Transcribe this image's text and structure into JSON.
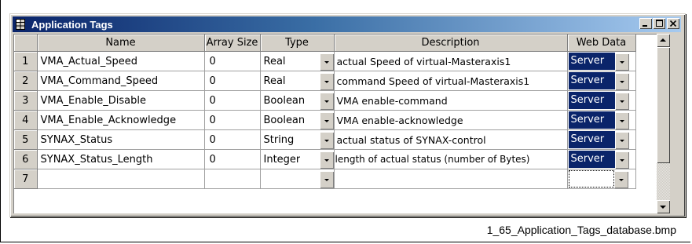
{
  "window": {
    "title": "Application Tags",
    "buttons": {
      "minimize": "_",
      "maximize": "□",
      "close": "✕"
    }
  },
  "table": {
    "headers": {
      "rownum": "",
      "name": "Name",
      "array_size": "Array Size",
      "type": "Type",
      "description": "Description",
      "web_data": "Web Data"
    },
    "rows": [
      {
        "num": "1",
        "name": "VMA_Actual_Speed",
        "array_size": "0",
        "type": "Real",
        "description": "actual Speed of virtual-Masteraxis1",
        "web_data": "Server"
      },
      {
        "num": "2",
        "name": "VMA_Command_Speed",
        "array_size": "0",
        "type": "Real",
        "description": "command Speed of virtual-Masteraxis1",
        "web_data": "Server"
      },
      {
        "num": "3",
        "name": "VMA_Enable_Disable",
        "array_size": "0",
        "type": "Boolean",
        "description": "VMA enable-command",
        "web_data": "Server"
      },
      {
        "num": "4",
        "name": "VMA_Enable_Acknowledge",
        "array_size": "0",
        "type": "Boolean",
        "description": "VMA enable-acknowledge",
        "web_data": "Server"
      },
      {
        "num": "5",
        "name": "SYNAX_Status",
        "array_size": "0",
        "type": "String",
        "description": "actual status of SYNAX-control",
        "web_data": "Server"
      },
      {
        "num": "6",
        "name": "SYNAX_Status_Length",
        "array_size": "0",
        "type": "Integer",
        "description": "length of actual status (number of Bytes)",
        "web_data": "Server"
      },
      {
        "num": "7",
        "name": "",
        "array_size": "",
        "type": "",
        "description": "",
        "web_data": ""
      }
    ]
  },
  "icons": {
    "app_icon": "grid-icon",
    "dropdown": "chevron-down-icon",
    "scroll_up": "arrow-up-icon",
    "scroll_down": "arrow-down-icon"
  },
  "colors": {
    "title_bar_start": "#0a246a",
    "title_bar_end": "#a6caf0",
    "selection": "#0a246a",
    "face": "#d4d0c8"
  },
  "caption": "1_65_Application_Tags_database.bmp"
}
